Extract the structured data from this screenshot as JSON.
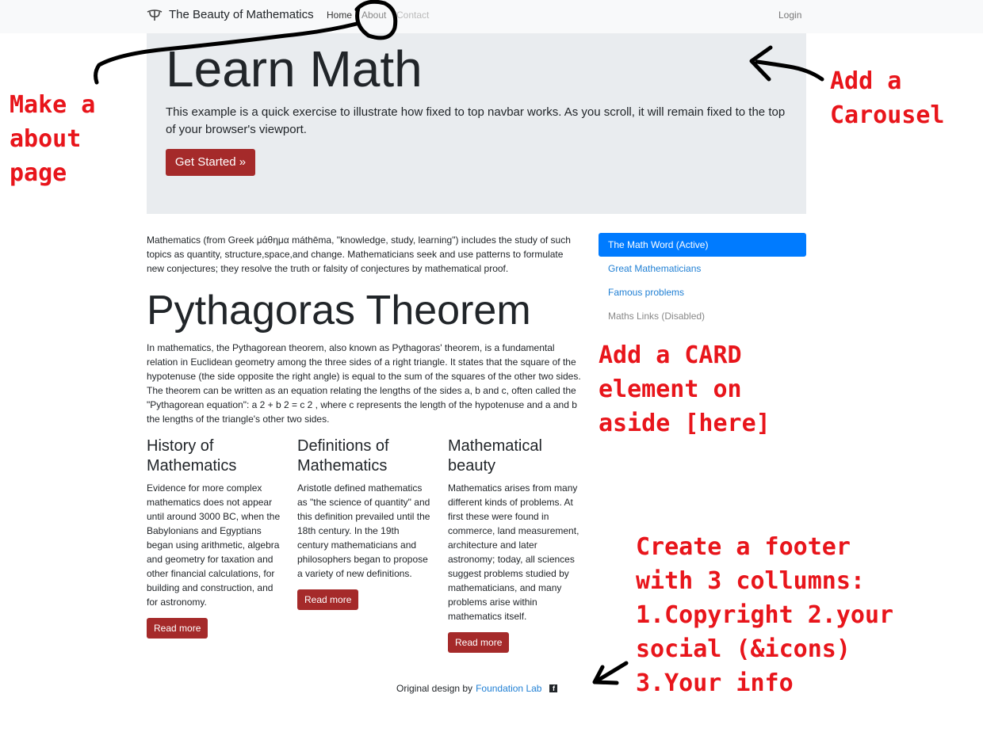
{
  "navbar": {
    "brand": "The Beauty of Mathematics",
    "brand_icon": "phi-icon",
    "links": [
      "Home",
      "About",
      "Contact"
    ],
    "login": "Login"
  },
  "jumbotron": {
    "title": "Learn Math",
    "text": "This example is a quick exercise to illustrate how fixed to top navbar works. As you scroll, it will remain fixed to the top of your browser's viewport.",
    "button": "Get Started »"
  },
  "main": {
    "intro": "Mathematics (from Greek μάθημα máthēma, \"knowledge, study, learning\") includes the study of such topics as quantity, structure,space,and change. Mathematicians seek and use patterns to formulate new conjectures; they resolve the truth or falsity of conjectures by mathematical proof.",
    "heading": "Pythagoras Theorem",
    "text": "In mathematics, the Pythagorean theorem, also known as Pythagoras' theorem, is a fundamental relation in Euclidean geometry among the three sides of a right triangle. It states that the square of the hypotenuse (the side opposite the right angle) is equal to the sum of the squares of the other two sides. The theorem can be written as an equation relating the lengths of the sides a, b and c, often called the \"Pythagorean equation\": a 2 + b 2 = c 2 , where c represents the length of the hypotenuse and a and b the lengths of the triangle's other two sides.",
    "columns": [
      {
        "title": "History of Mathematics",
        "text": "Evidence for more complex mathematics does not appear until around 3000 BC, when the Babylonians and Egyptians began using arithmetic, algebra and geometry for taxation and other financial calculations, for building and construction, and for astronomy.",
        "button": "Read more"
      },
      {
        "title": "Definitions of Mathematics",
        "text": "Aristotle defined mathematics as \"the science of quantity\" and this definition prevailed until the 18th century. In the 19th century mathematicians and philosophers began to propose a variety of new definitions.",
        "button": "Read more"
      },
      {
        "title": "Mathematical beauty",
        "text": "Mathematics arises from many different kinds of problems. At first these were found in commerce, land measurement, architecture and later astronomy; today, all sciences suggest problems studied by mathematicians, and many problems arise within mathematics itself.",
        "button": "Read more"
      }
    ]
  },
  "sidebar": {
    "items": [
      {
        "label": "The Math Word (Active)"
      },
      {
        "label": "Great Mathematicians"
      },
      {
        "label": "Famous problems"
      },
      {
        "label": "Maths Links (Disabled)"
      }
    ]
  },
  "footer": {
    "text": "Original design by",
    "link": "Foundation Lab",
    "icon": "facebook-icon"
  },
  "annotations": {
    "about": [
      "Make a",
      "about",
      "page"
    ],
    "carousel": [
      "Add a",
      "Carousel"
    ],
    "card": [
      "Add a CARD",
      "element on",
      "aside [here]"
    ],
    "footer": [
      "Create a footer",
      "with 3 collumns:",
      "1.Copyright 2.your",
      "social (&icons)",
      "3.Your info"
    ],
    "color": "#e8151b"
  }
}
